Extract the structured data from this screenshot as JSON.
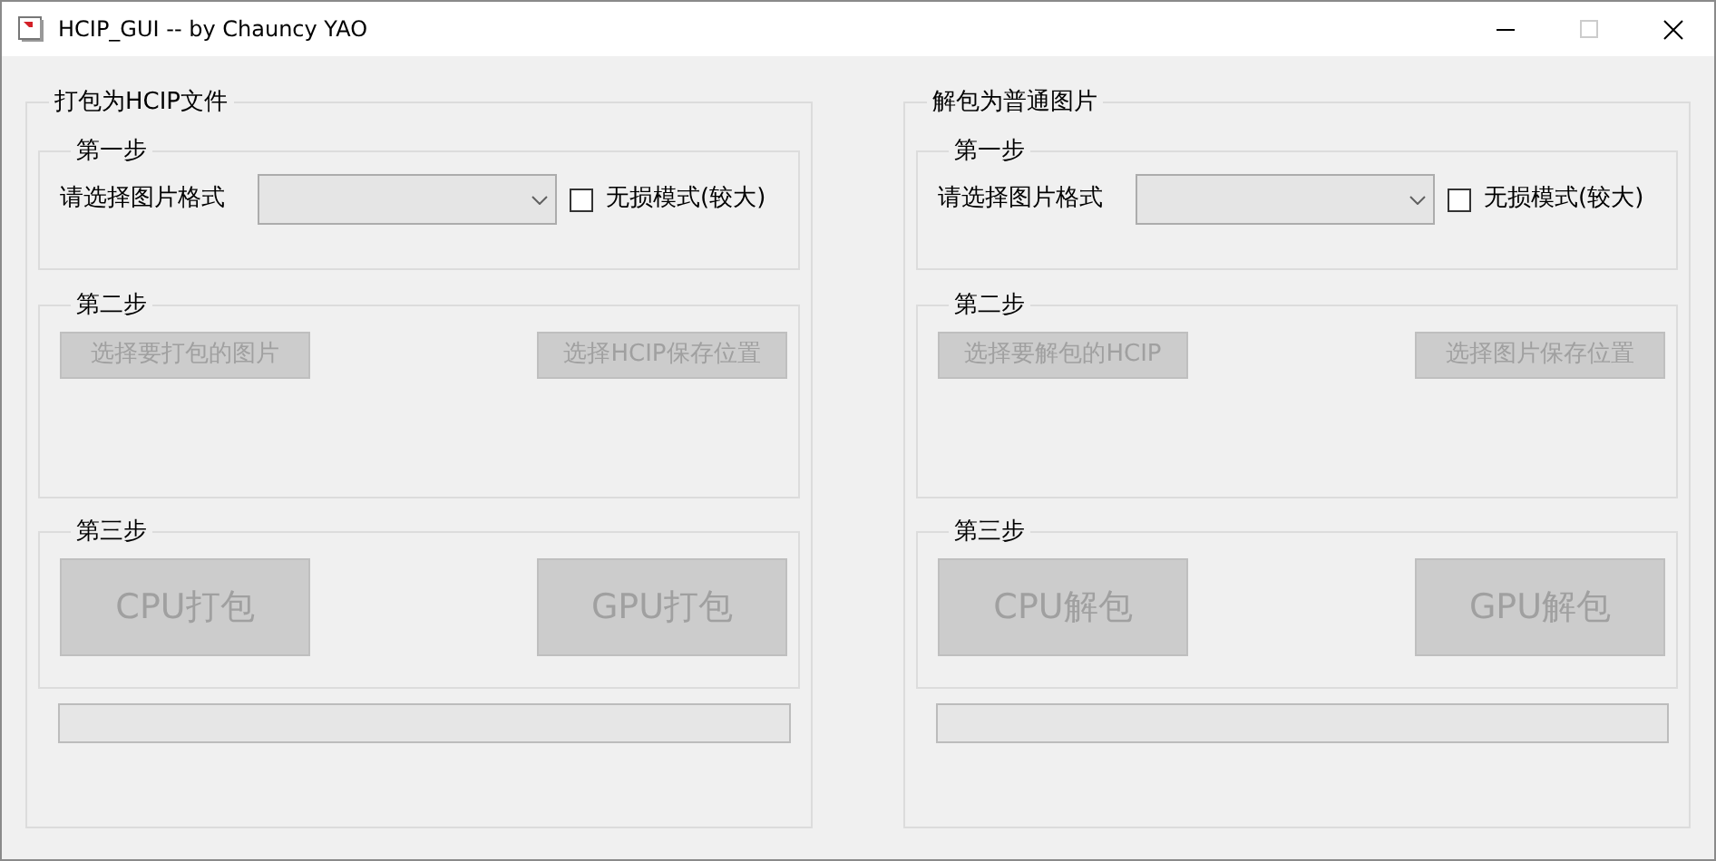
{
  "window": {
    "title": "HCIP_GUI -- by Chauncy YAO",
    "controls": [
      {
        "kind": "minimize",
        "disabled": false
      },
      {
        "kind": "maximize",
        "disabled": true
      },
      {
        "kind": "close",
        "disabled": false
      }
    ]
  },
  "panels": [
    {
      "title": "打包为HCIP文件",
      "step1": {
        "legend": "第一步",
        "label": "请选择图片格式",
        "dropdown": {
          "disabled": false
        },
        "checkbox": {
          "label": "无损模式(较大)",
          "checked": false
        }
      },
      "step2": {
        "legend": "第二步",
        "buttons": [
          {
            "label": "选择要打包的图片",
            "disabled": true
          },
          {
            "label": "选择HCIP保存位置",
            "disabled": true
          }
        ]
      },
      "step3": {
        "legend": "第三步",
        "buttons": [
          {
            "label": "CPU打包",
            "disabled": true
          },
          {
            "label": "GPU打包",
            "disabled": true
          }
        ]
      },
      "progress": {
        "level": 0
      }
    },
    {
      "title": "解包为普通图片",
      "step1": {
        "legend": "第一步",
        "label": "请选择图片格式",
        "dropdown": {
          "disabled": false
        },
        "checkbox": {
          "label": "无损模式(较大)",
          "checked": false
        }
      },
      "step2": {
        "legend": "第二步",
        "buttons": [
          {
            "label": "选择要解包的HCIP",
            "disabled": true
          },
          {
            "label": "选择图片保存位置",
            "disabled": true
          }
        ]
      },
      "step3": {
        "legend": "第三步",
        "buttons": [
          {
            "label": "CPU解包",
            "disabled": true
          },
          {
            "label": "GPU解包",
            "disabled": true
          }
        ]
      },
      "progress": {
        "level": 0
      }
    }
  ]
}
